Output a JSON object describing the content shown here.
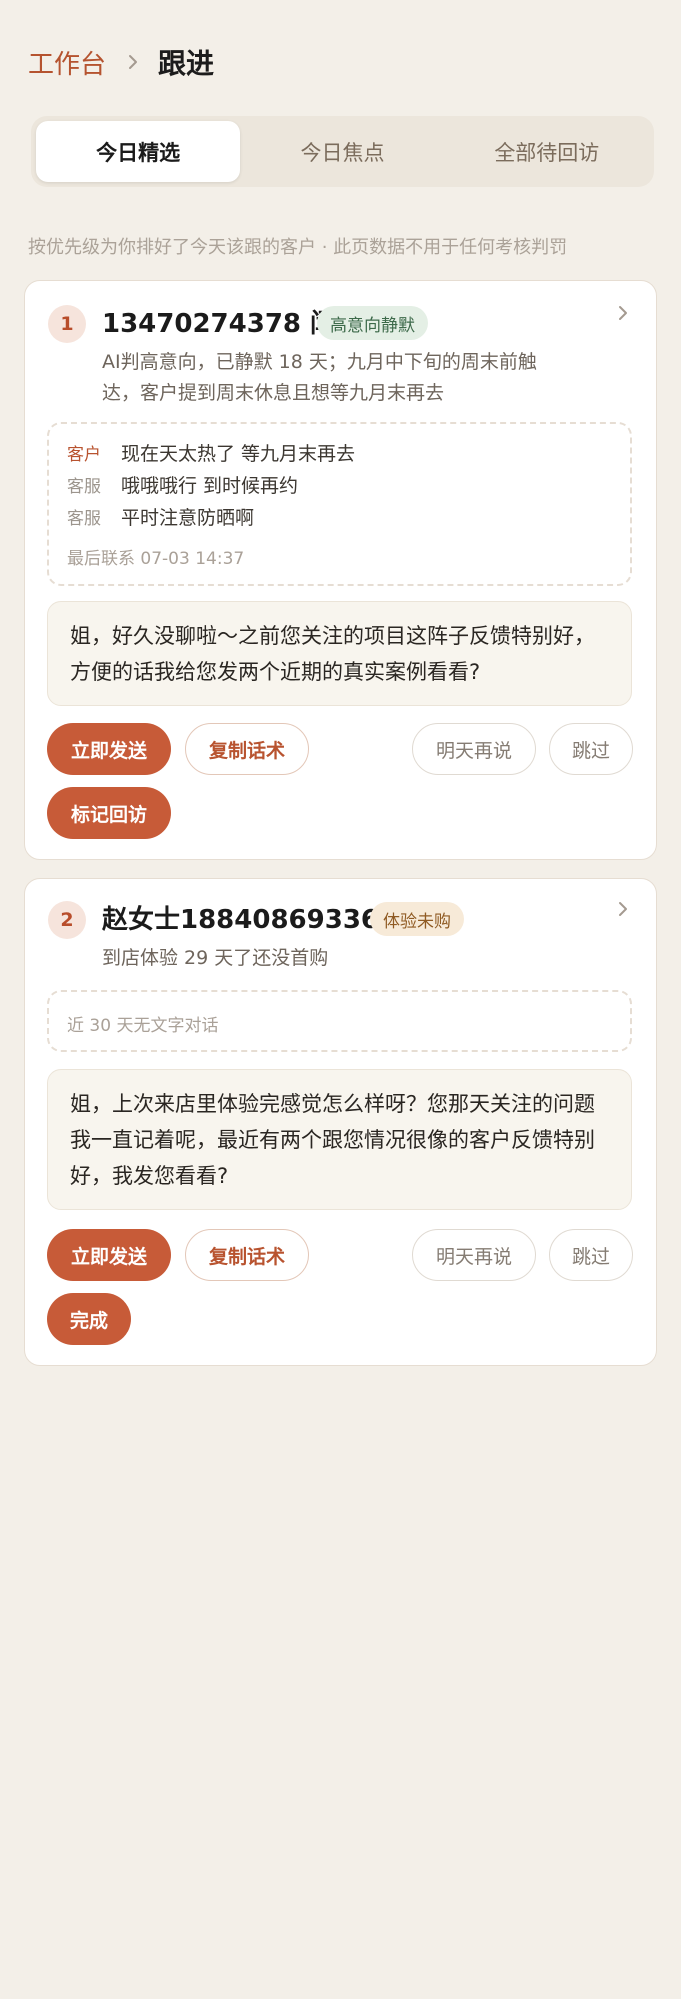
{
  "breadcrumb": {
    "parent": "工作台",
    "current": "跟进"
  },
  "tabs": [
    {
      "label": "今日精选",
      "active": true
    },
    {
      "label": "今日焦点",
      "active": false
    },
    {
      "label": "全部待回访",
      "active": false
    }
  ],
  "hint": "按优先级为你排好了今天该跟的客户 · 此页数据不用于任何考核判罚",
  "cards": [
    {
      "rank": "1",
      "name": "13470274378 闫",
      "tag": "高意向静默",
      "reason_lines": [
        "AI判高意向，已静默 18 天；九月中下旬的周末前触",
        "达，客户提到周末休息且想等九月末再去"
      ],
      "conversation": [
        {
          "role": "客户",
          "text": "现在天太热了 等九月末再去"
        },
        {
          "role": "客服",
          "text": "哦哦哦行 到时候再约"
        },
        {
          "role": "客服",
          "text": "平时注意防晒啊"
        }
      ],
      "last_contact": "最后联系 07-03 14:37",
      "script": "姐，好久没聊啦～之前您关注的项目这阵子反馈特别好，方便的话我给您发两个近期的真实案例看看?",
      "buttons": {
        "send": "立即发送",
        "copy": "复制话术",
        "later": "明天再说",
        "skip": "跳过",
        "mark": "标记回访"
      }
    },
    {
      "rank": "2",
      "name": "赵女士18840869336",
      "tag": "体验未购",
      "reason_lines": [
        "到店体验 29 天了还没首购"
      ],
      "conversation_empty": "近 30 天无文字对话",
      "script": "姐，上次来店里体验完感觉怎么样呀？您那天关注的问题我一直记着呢，最近有两个跟您情况很像的客户反馈特别好，我发您看看?",
      "buttons": {
        "send": "立即发送",
        "copy": "复制话术",
        "later": "明天再说",
        "skip": "跳过",
        "done": "完成"
      }
    }
  ],
  "icons": {
    "breadcrumb_separator": "chevron-right-icon",
    "card_open": "chevron-right-icon"
  },
  "colors": {
    "accent": "#c75b38",
    "accent_text": "#b8532f",
    "background": "#f3efe8",
    "tag_green_bg": "#e4efe5",
    "tag_amber_bg": "#f7ead8"
  }
}
